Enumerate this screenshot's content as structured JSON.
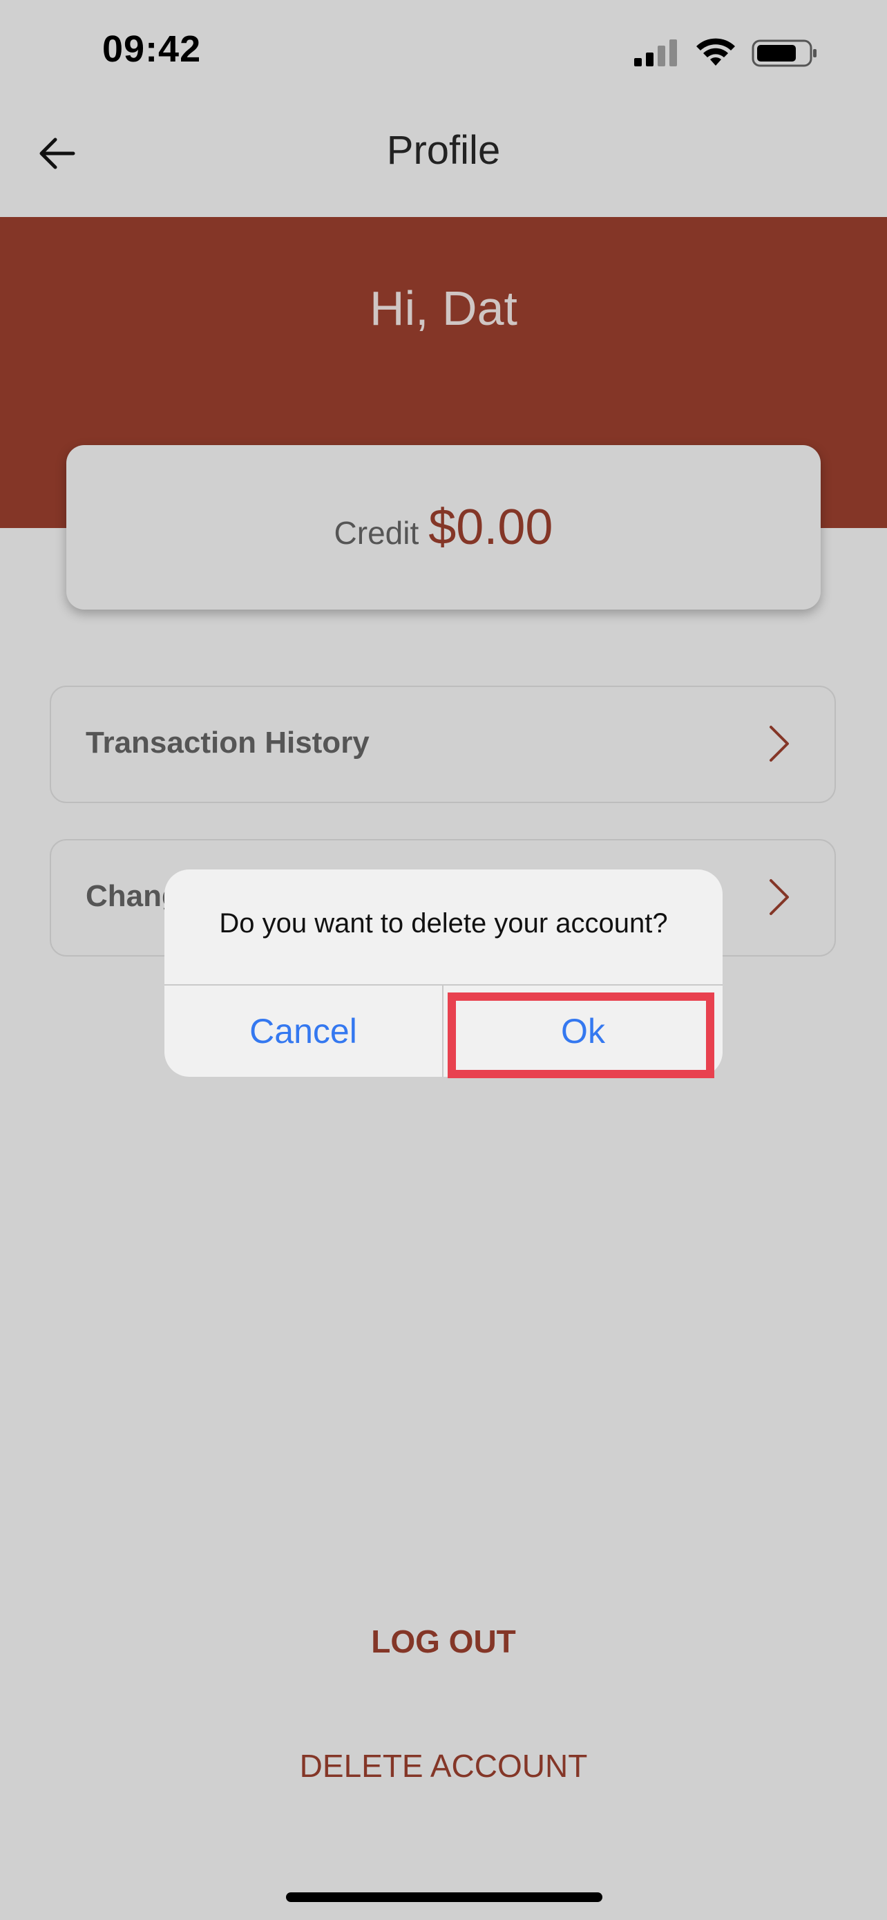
{
  "status_bar": {
    "time": "09:42"
  },
  "header": {
    "title": "Profile"
  },
  "hero": {
    "greeting": "Hi, Dat"
  },
  "credit": {
    "label": "Credit",
    "value": "$0.00"
  },
  "menu": {
    "items": [
      {
        "label": "Transaction History"
      },
      {
        "label": "Change"
      }
    ]
  },
  "actions": {
    "logout_label": "LOG OUT",
    "delete_label": "DELETE ACCOUNT"
  },
  "alert": {
    "message": "Do you want to delete your account?",
    "cancel_label": "Cancel",
    "ok_label": "Ok"
  },
  "colors": {
    "brand": "#843627",
    "background": "#d0d0d0",
    "ios_blue": "#3478f0",
    "highlight": "#e8414f"
  },
  "icons": {
    "back": "arrow-left-icon",
    "chevron": "chevron-right-icon",
    "signal": "cellular-signal-icon",
    "wifi": "wifi-icon",
    "battery": "battery-icon"
  }
}
